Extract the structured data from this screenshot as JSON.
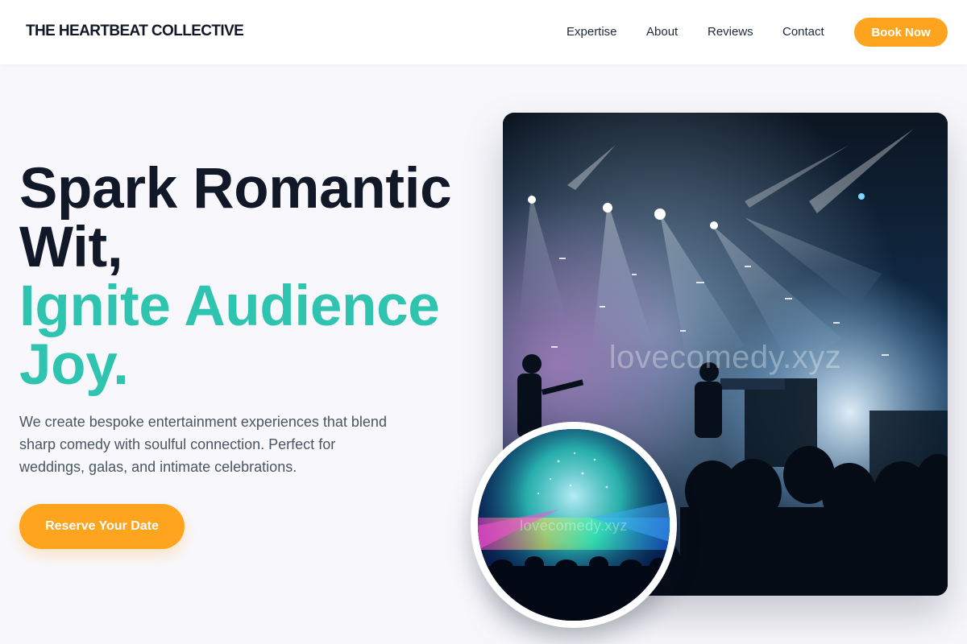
{
  "header": {
    "brand": "THE HEARTBEAT COLLECTIVE",
    "nav": [
      "Expertise",
      "About",
      "Reviews",
      "Contact"
    ],
    "cta_label": "Book Now"
  },
  "hero": {
    "headline_line1": "Spark Romantic",
    "headline_line2": "Wit,",
    "headline_line3": "Ignite Audience",
    "headline_line4": "Joy.",
    "description": "We create bespoke entertainment experiences that blend sharp comedy with soulful connection. Perfect for weddings, galas, and intimate celebrations.",
    "cta_label": "Reserve Your Date"
  },
  "images": {
    "main_watermark": "lovecomedy.xyz",
    "inset_watermark": "lovecomedy.xyz"
  },
  "colors": {
    "accent": "#2ec4b0",
    "cta": "#ffa41f",
    "text": "#111827",
    "muted": "#4b5563",
    "background": "#f8f8fc"
  }
}
